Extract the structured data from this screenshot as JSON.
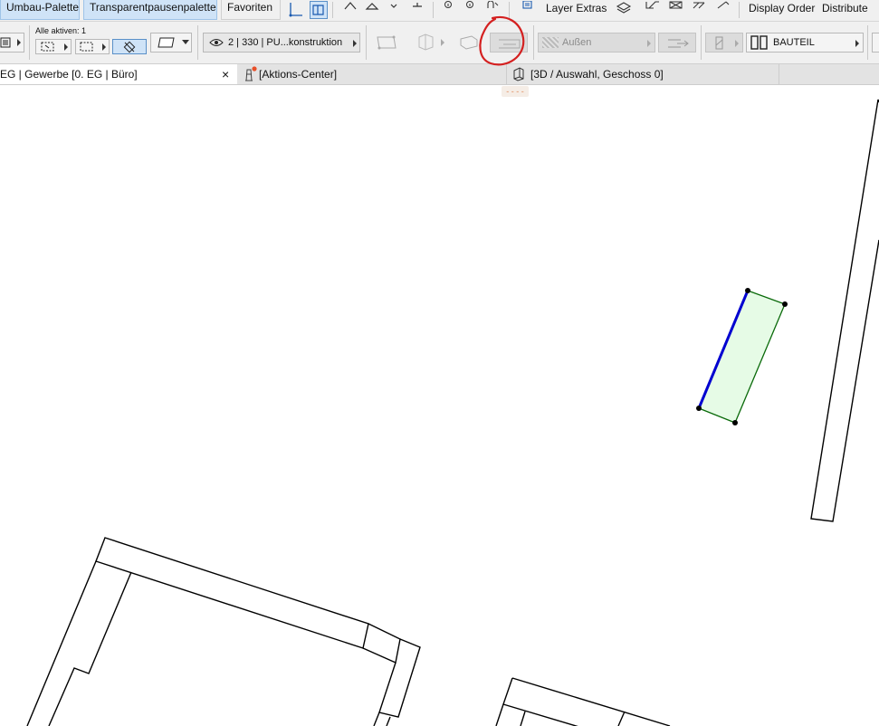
{
  "toolbar_top": {
    "palette1": "Umbau-Palette",
    "palette2": "Transparentpausenpalette",
    "favorites": "Favoriten",
    "layer_extras": "Layer Extras",
    "display_order": "Display Order",
    "distribute": "Distribute"
  },
  "toolbar_info": {
    "selection_label": "Alle aktiven: 1",
    "layer_combo": "2 | 330 | PU...konstruktion",
    "surface_value": "Außen",
    "component_value": "BAUTEIL"
  },
  "tabs": [
    {
      "label": "EG | Gewerbe [0. EG | Büro]",
      "close": "×"
    },
    {
      "label": "[Aktions-Center]"
    },
    {
      "label": "[3D / Auswahl, Geschoss 0]"
    }
  ],
  "tooltip_dashes": "- - - -",
  "colors": {
    "toolbar_bg": "#f0f0f0",
    "palette_btn": "#cfe3f7",
    "selection_fill": "#e6fbe6",
    "selection_edge": "#0a6a0a",
    "selected_edge": "#0000d0",
    "annotation_red": "#d42020"
  }
}
